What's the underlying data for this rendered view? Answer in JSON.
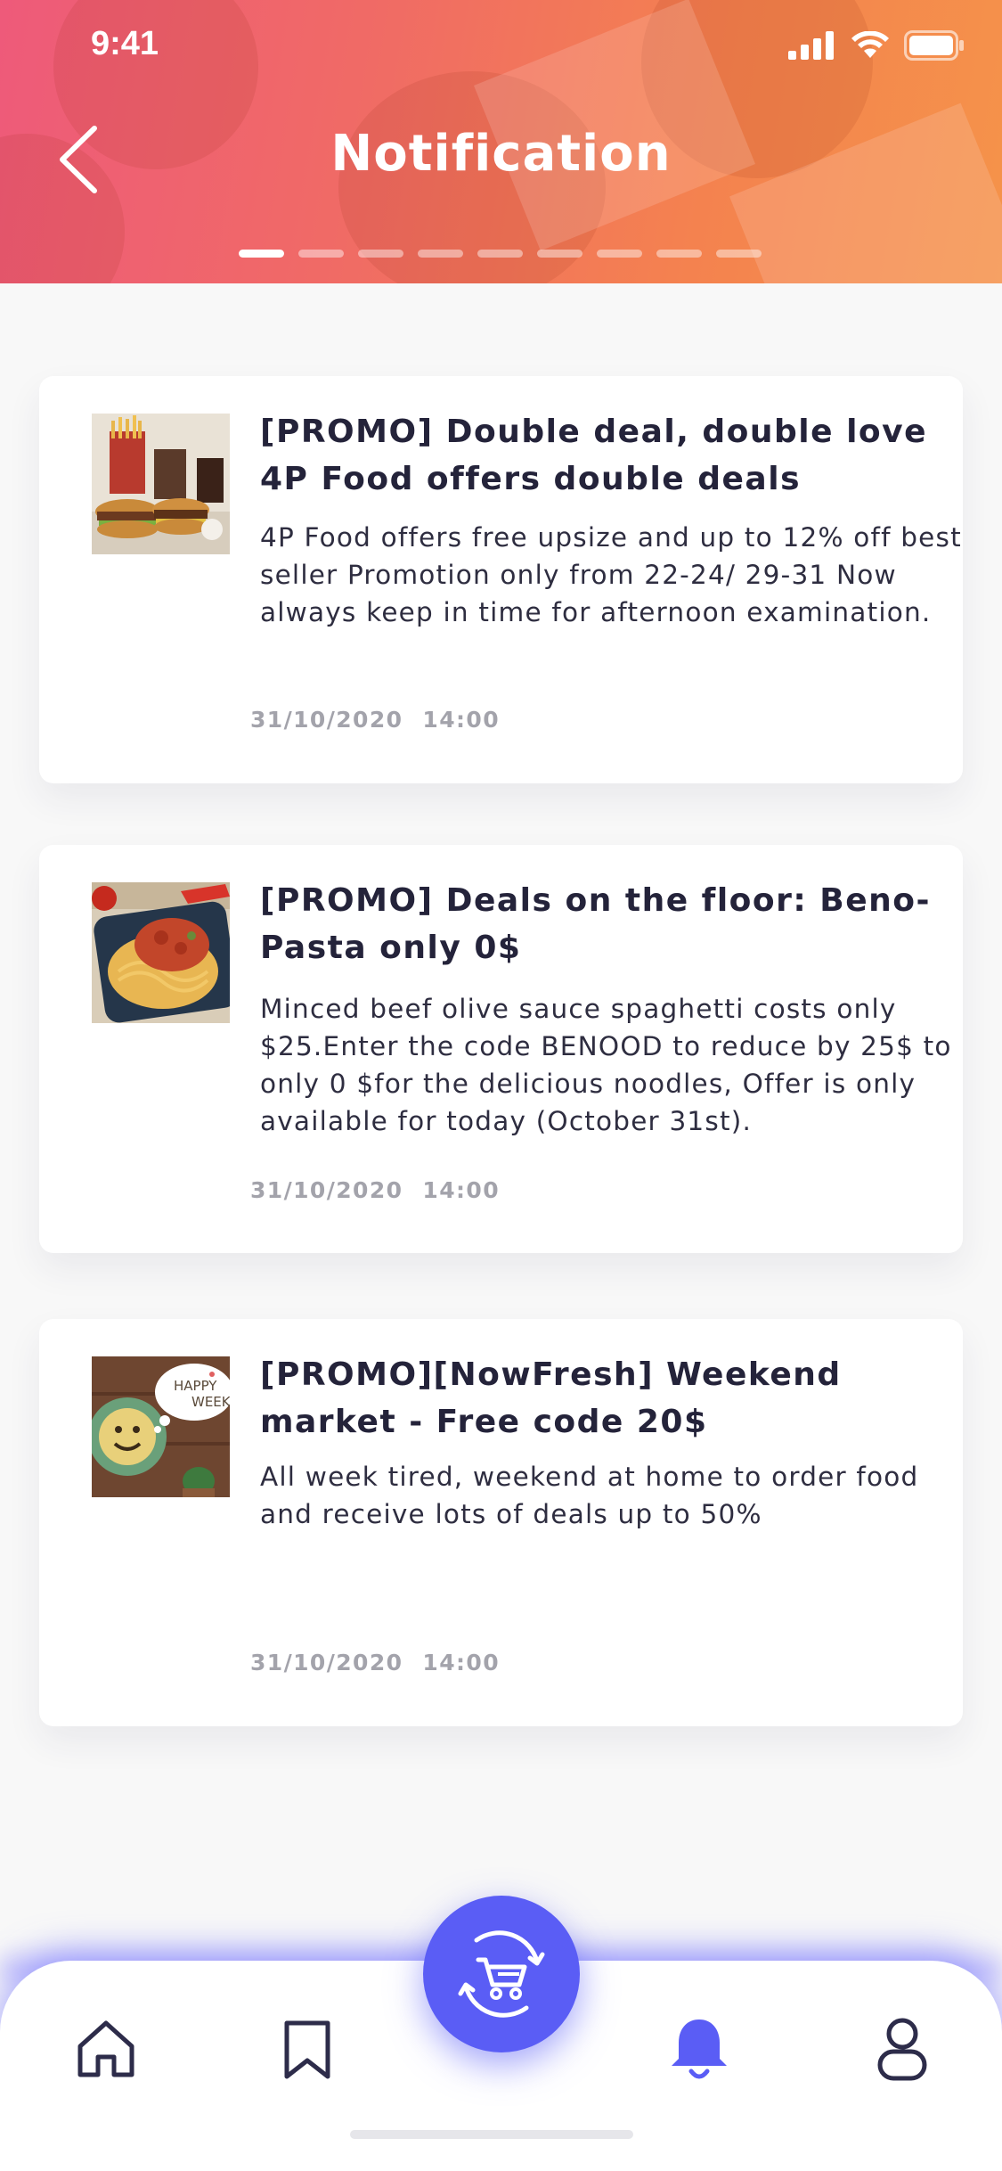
{
  "status_bar": {
    "time": "9:41"
  },
  "header": {
    "title": "Notification"
  },
  "pager": {
    "count": 9,
    "active_index": 0
  },
  "notifications": [
    {
      "title": "[PROMO] Double deal, double love 4P Food offers double deals",
      "body": "4P Food offers free upsize and up to 12% off best seller Promotion only from 22-24/ 29-31 Now always keep in time for afternoon examination.",
      "date": "31/10/2020",
      "time": "14:00"
    },
    {
      "title": "[PROMO] Deals on the floor: Beno-Pasta only 0$",
      "body": "Minced beef olive sauce spaghetti costs only $25.Enter the code BENOOD to reduce by 25$ to only 0 $for the delicious noodles, Offer is only available for today (October 31st).",
      "date": "31/10/2020",
      "time": "14:00"
    },
    {
      "title": "[PROMO][NowFresh] Weekend market - Free code 20$",
      "body": "All week tired, weekend at home to order food and receive lots of deals up to 50%",
      "date": "31/10/2020",
      "time": "14:00",
      "thumb_text": "HAPPY WEEKEND"
    }
  ],
  "tabbar": {
    "items": [
      "home-icon",
      "bookmark-icon",
      "cart-icon",
      "bell-icon",
      "profile-icon"
    ],
    "active": "bell-icon"
  },
  "colors": {
    "accent": "#5a5df5",
    "header_gradient_start": "#ee5a7a",
    "header_gradient_end": "#f5934a",
    "title_text": "#24233a",
    "meta_text": "#a3a3ab"
  }
}
